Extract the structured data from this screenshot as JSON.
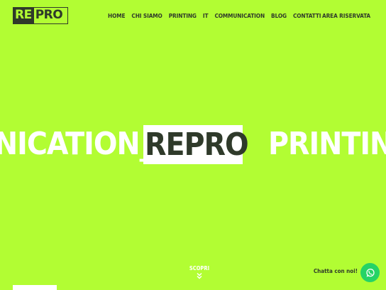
{
  "header": {
    "logo": {
      "part1": "RE",
      "part2": "PRO"
    },
    "nav": [
      "HOME",
      "CHI SIAMO",
      "PRINTING",
      "IT",
      "COMMUNICATION",
      "BLOG",
      "CONTATTI"
    ],
    "area_riservata": "AREA RISERVATA"
  },
  "hero": {
    "ticker": [
      "NICATION_",
      "REPRO",
      "PRINTING"
    ]
  },
  "scopri": {
    "label": "SCOPRI",
    "icon": "double-chevron-down-icon"
  },
  "chat": {
    "label": "Chatta con noi!",
    "icon": "whatsapp-icon"
  },
  "colors": {
    "background": "#b2fd33",
    "dark": "#2f3a2a",
    "white": "#ffffff",
    "whatsapp": "#25d366"
  }
}
